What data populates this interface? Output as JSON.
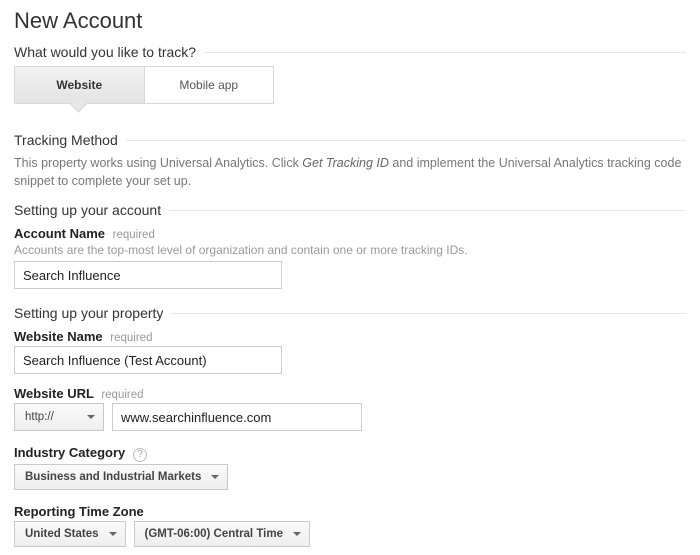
{
  "page_title": "New Account",
  "track_question": "What would you like to track?",
  "tabs": {
    "website": "Website",
    "mobile": "Mobile app"
  },
  "tracking_method": {
    "heading": "Tracking Method",
    "text_before": "This property works using Universal Analytics. Click ",
    "cta_italic": "Get Tracking ID",
    "text_after": " and implement the Universal Analytics tracking code snippet to complete your set up."
  },
  "account_setup": {
    "heading": "Setting up your account",
    "name_label": "Account Name",
    "required": "required",
    "name_hint": "Accounts are the top-most level of organization and contain one or more tracking IDs.",
    "name_value": "Search Influence"
  },
  "property_setup": {
    "heading": "Setting up your property",
    "site_name_label": "Website Name",
    "site_name_value": "Search Influence (Test Account)",
    "site_url_label": "Website URL",
    "protocol_value": "http://",
    "site_url_value": "www.searchinfluence.com",
    "industry_label": "Industry Category",
    "industry_value": "Business and Industrial Markets",
    "tz_label": "Reporting Time Zone",
    "tz_country": "United States",
    "tz_value": "(GMT-06:00) Central Time"
  }
}
